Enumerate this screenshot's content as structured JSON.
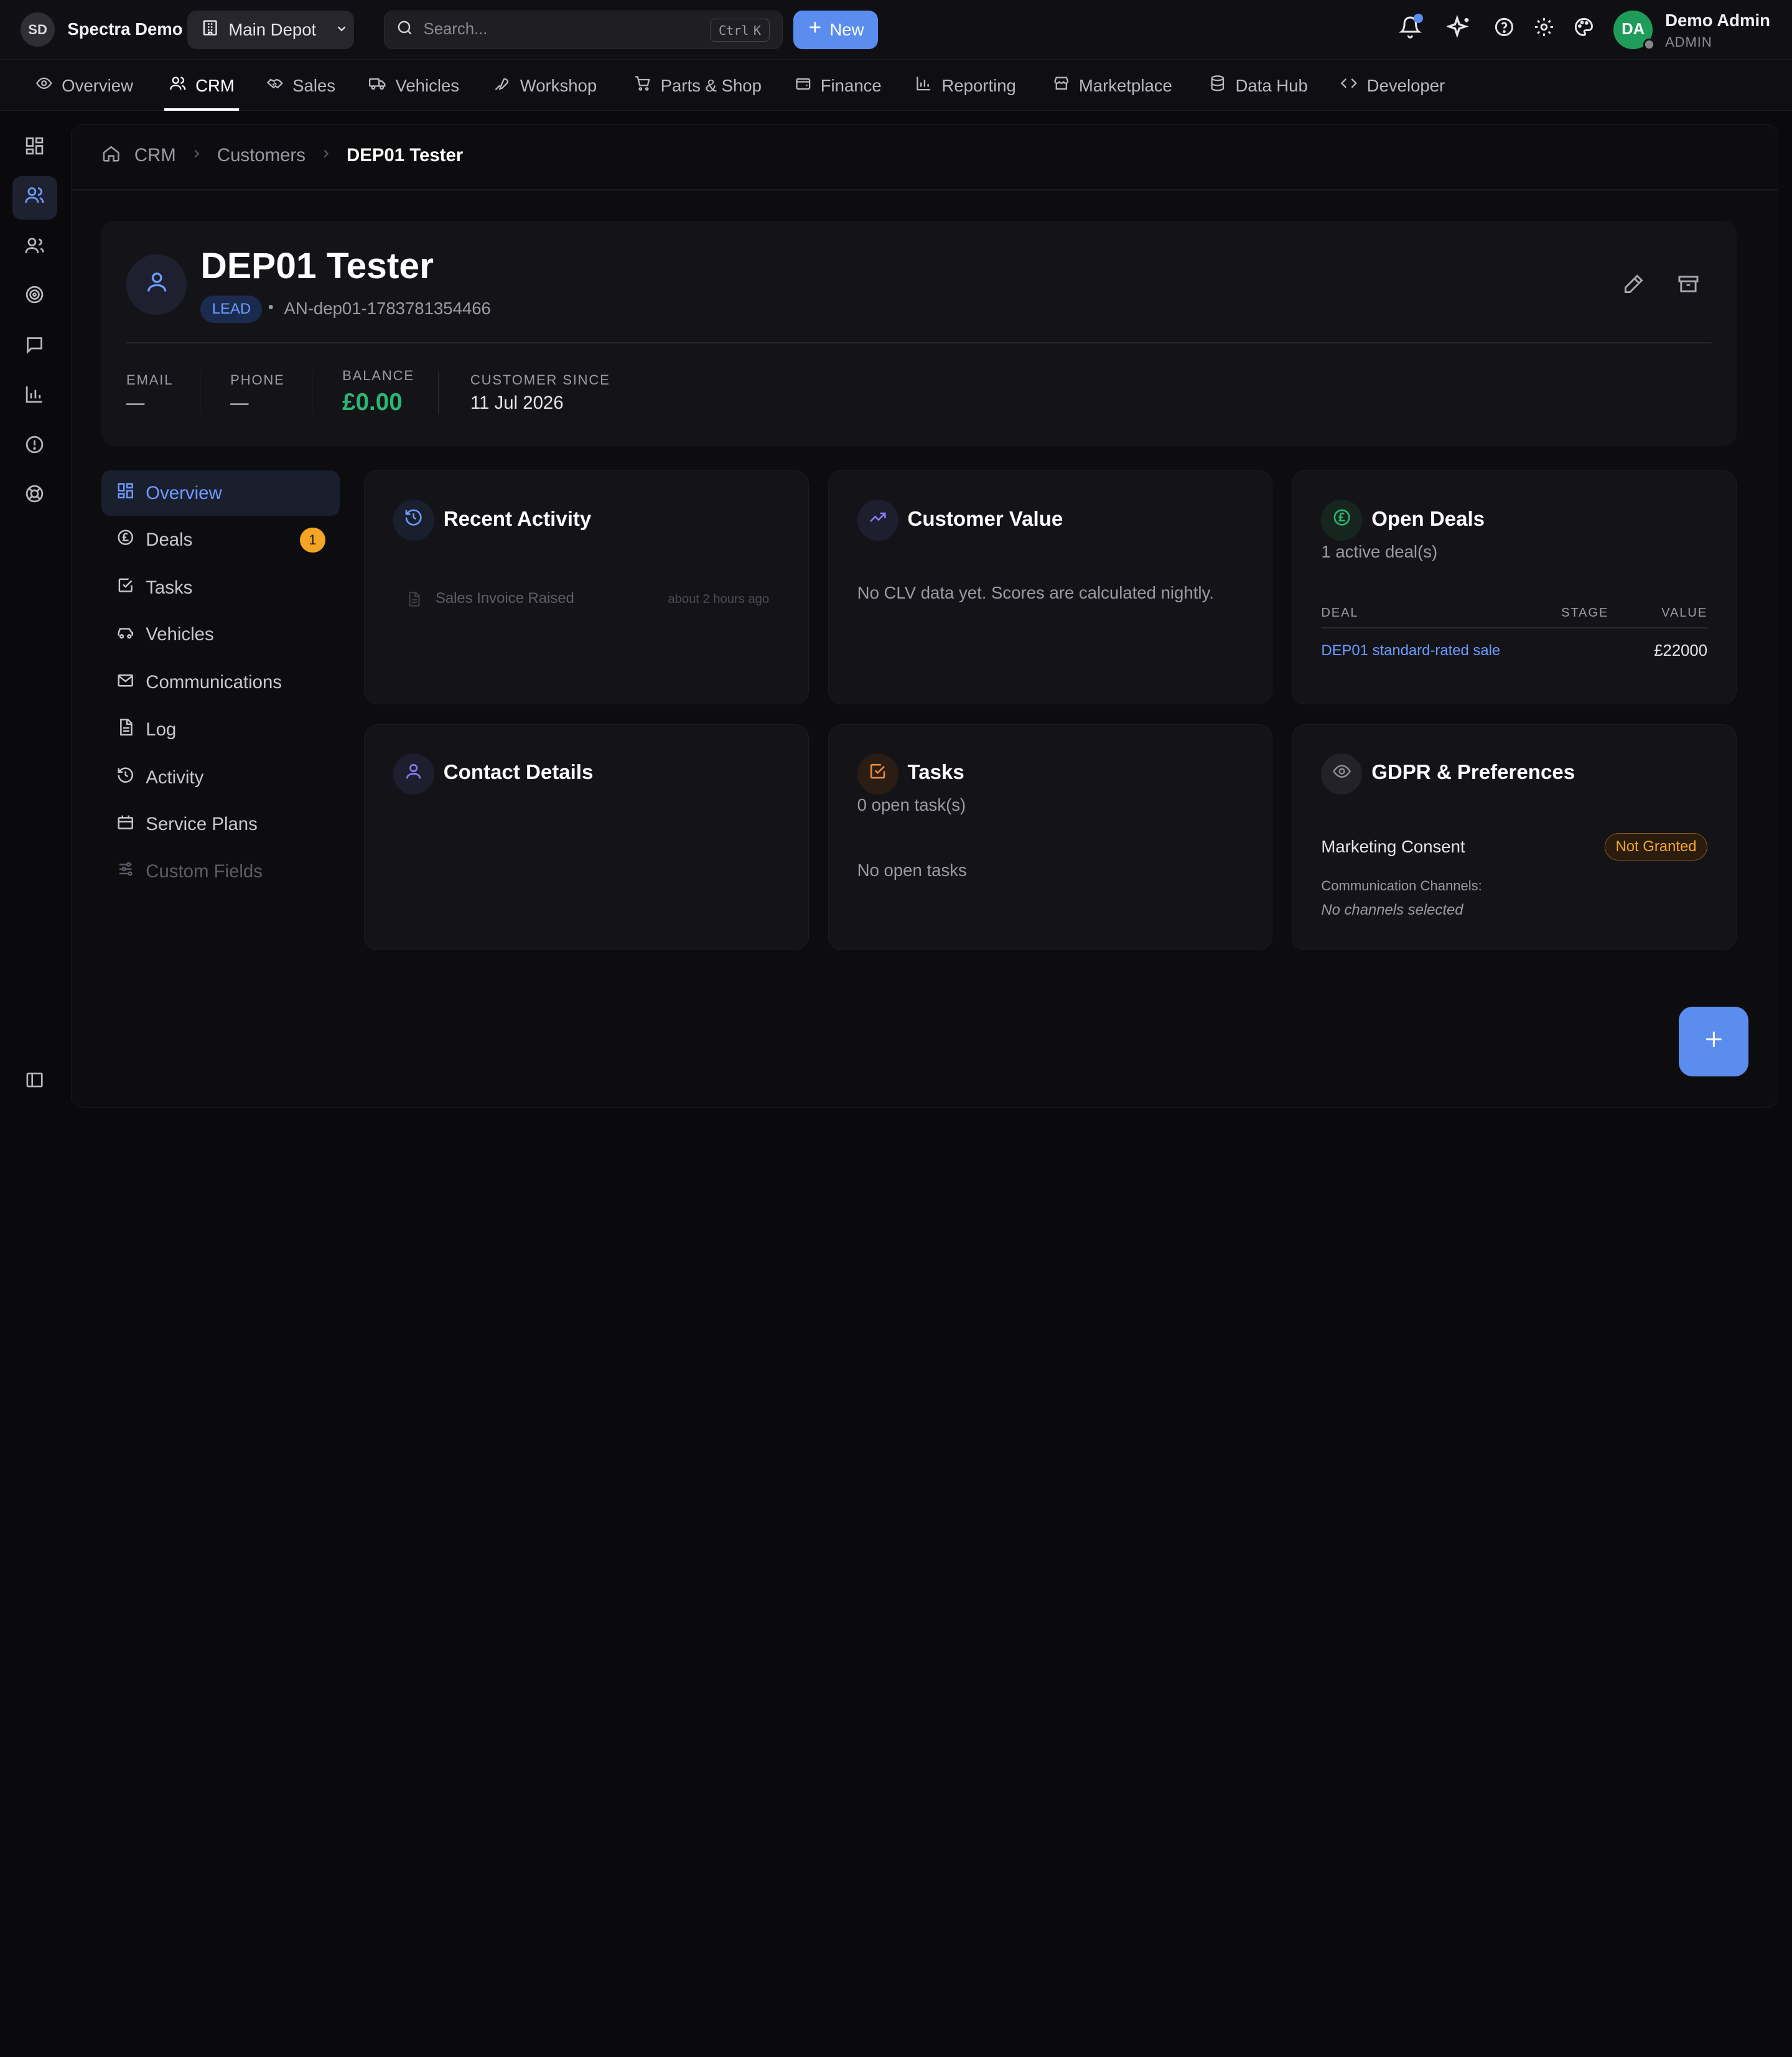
{
  "brand": {
    "initials": "SD",
    "name": "Spectra Demo"
  },
  "depot": {
    "label": "Main Depot"
  },
  "search": {
    "placeholder": "Search...",
    "kbd1": "Ctrl",
    "kbd2": "K"
  },
  "new_button": "New",
  "user": {
    "initials": "DA",
    "name": "Demo Admin",
    "role": "ADMIN"
  },
  "nav": {
    "tabs": [
      {
        "label": "Overview"
      },
      {
        "label": "CRM"
      },
      {
        "label": "Sales"
      },
      {
        "label": "Vehicles"
      },
      {
        "label": "Workshop"
      },
      {
        "label": "Parts & Shop"
      },
      {
        "label": "Finance"
      },
      {
        "label": "Reporting"
      },
      {
        "label": "Marketplace"
      },
      {
        "label": "Data Hub"
      },
      {
        "label": "Developer"
      }
    ]
  },
  "breadcrumb": {
    "crm": "CRM",
    "customers": "Customers",
    "current": "DEP01 Tester"
  },
  "customer": {
    "name": "DEP01 Tester",
    "type_badge": "LEAD",
    "separator": "•",
    "ref": "AN-dep01-1783781354466",
    "stats": {
      "email_label": "EMAIL",
      "email_value": "—",
      "phone_label": "PHONE",
      "phone_value": "—",
      "balance_label": "BALANCE",
      "balance_value": "£0.00",
      "since_label": "CUSTOMER SINCE",
      "since_value": "11 Jul 2026"
    }
  },
  "subnav": {
    "items": [
      {
        "label": "Overview"
      },
      {
        "label": "Deals",
        "badge": "1"
      },
      {
        "label": "Tasks"
      },
      {
        "label": "Vehicles"
      },
      {
        "label": "Communications"
      },
      {
        "label": "Log"
      },
      {
        "label": "Activity"
      },
      {
        "label": "Service Plans"
      },
      {
        "label": "Custom Fields"
      }
    ]
  },
  "cards": {
    "recent_activity": {
      "title": "Recent Activity",
      "item_label": "Sales Invoice Raised",
      "item_time": "about 2 hours ago"
    },
    "customer_value": {
      "title": "Customer Value",
      "body": "No CLV data yet. Scores are calculated nightly."
    },
    "open_deals": {
      "title": "Open Deals",
      "subtitle": "1 active deal(s)",
      "col_deal": "DEAL",
      "col_stage": "STAGE",
      "col_value": "VALUE",
      "rows": [
        {
          "deal": "DEP01 standard-rated sale",
          "stage": "",
          "value": "£22000"
        }
      ]
    },
    "contact_details": {
      "title": "Contact Details"
    },
    "tasks": {
      "title": "Tasks",
      "subtitle": "0 open task(s)",
      "empty": "No open tasks"
    },
    "gdpr": {
      "title": "GDPR & Preferences",
      "consent_label": "Marketing Consent",
      "consent_badge": "Not Granted",
      "channels_label": "Communication Channels:",
      "channels_value": "No channels selected"
    }
  },
  "colors": {
    "accent": "#5b8def",
    "success": "#2bb673",
    "warning": "#f5a524",
    "background": "#0a0a0d"
  }
}
